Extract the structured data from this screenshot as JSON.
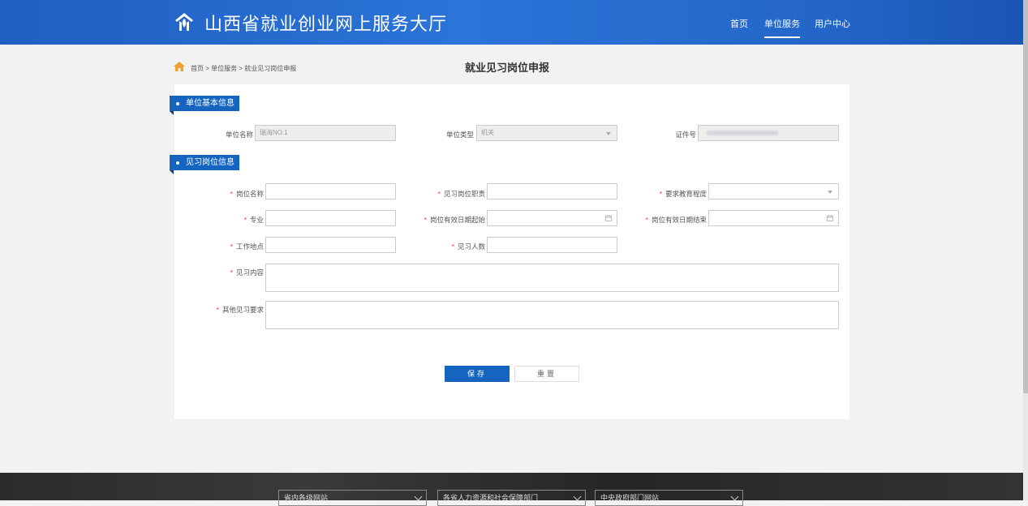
{
  "header": {
    "site_title": "山西省就业创业网上服务大厅",
    "nav": [
      {
        "label": "首页"
      },
      {
        "label": "单位服务"
      },
      {
        "label": "用户中心"
      }
    ]
  },
  "breadcrumb": {
    "home": "首页",
    "sep1": ">",
    "service": "单位服务",
    "sep2": ">",
    "current": "就业见习岗位申报"
  },
  "page_title": "就业见习岗位申报",
  "basic_info": {
    "section_title": "单位基本信息",
    "unit_name_label": "单位名称",
    "unit_name_value": "瑞海NO.1",
    "unit_type_label": "单位类型",
    "unit_type_value": "机关",
    "cert_no_label": "证件号"
  },
  "post_info": {
    "section_title": "见习岗位信息",
    "required_mark": "*",
    "post_name_label": "岗位名称",
    "post_duty_label": "见习岗位职责",
    "education_label": "要求教育程度",
    "major_label": "专业",
    "start_date_label": "岗位有效日期起始",
    "end_date_label": "岗位有效日期结束",
    "location_label": "工作地点",
    "count_label": "见习人数",
    "content_label": "见习内容",
    "other_label": "其他见习要求"
  },
  "actions": {
    "save": "保存",
    "reset": "重置"
  },
  "footer": {
    "selects": [
      "省内各级网站",
      "各省人力资源和社会保障部门",
      "中央政府部门网站"
    ]
  },
  "colors": {
    "header_blue": "#2466c8",
    "primary": "#1565c0",
    "required": "#e53935"
  }
}
